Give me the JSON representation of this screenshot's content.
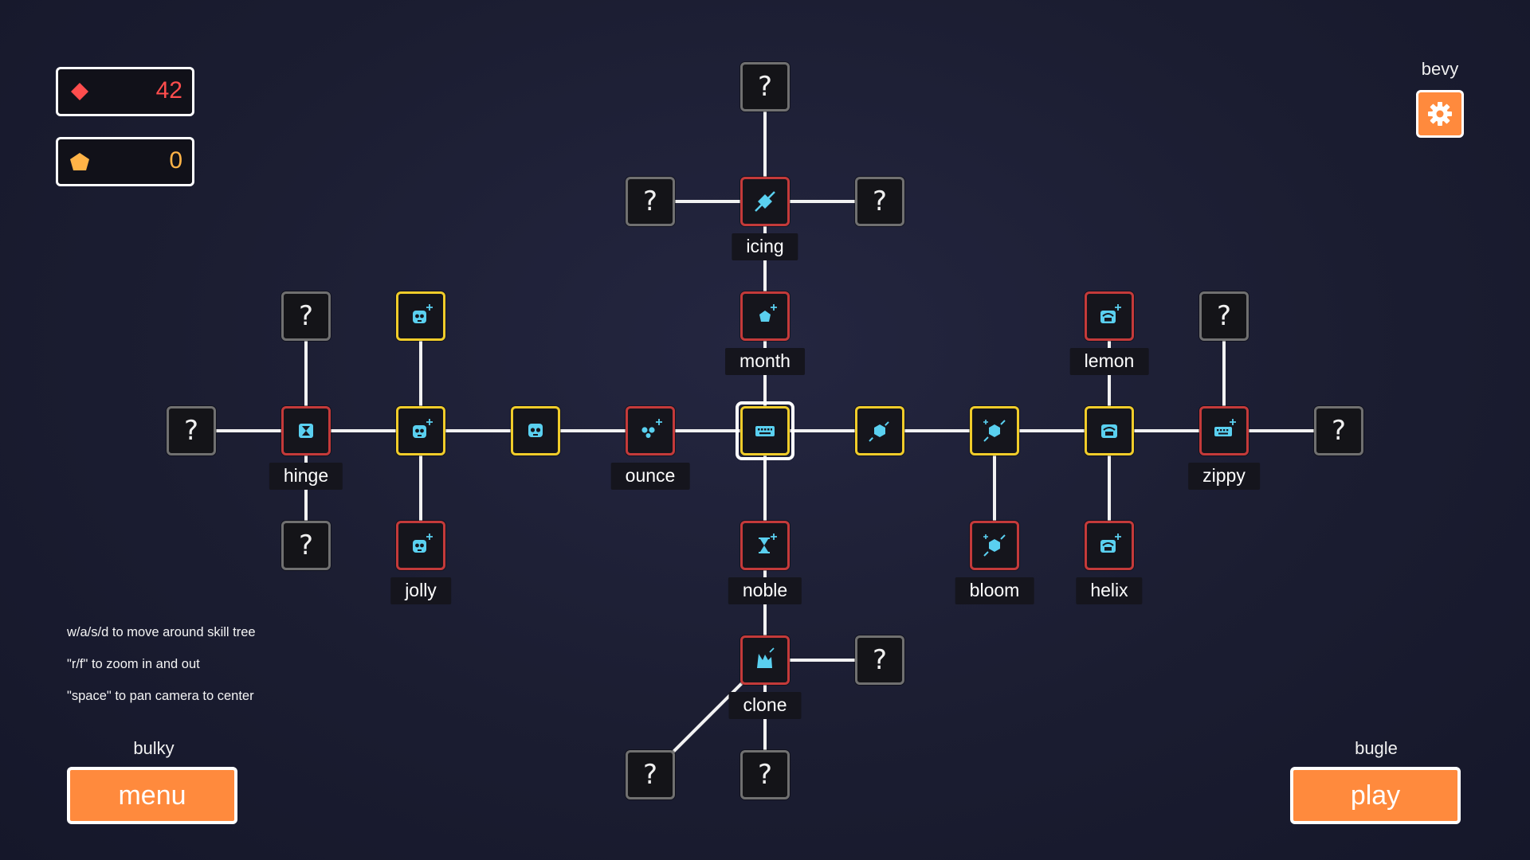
{
  "currencies": {
    "red_gems": {
      "icon": "red-diamond-icon",
      "value": "42",
      "color": "#ff4d4d"
    },
    "gold_gems": {
      "icon": "gold-pentagon-icon",
      "value": "0",
      "color": "#ffb347"
    }
  },
  "hints": [
    "w/a/s/d to move around skill tree",
    "\"r/f\" to zoom in and out",
    "\"space\" to pan camera to center"
  ],
  "top_right": {
    "caption": "bevy",
    "settings_icon": "gear-icon"
  },
  "menu": {
    "caption": "bulky",
    "label": "menu"
  },
  "play": {
    "caption": "bugle",
    "label": "play"
  },
  "colors": {
    "accent": "#ff8a3d",
    "red_border": "#c43a3a",
    "yellow_border": "#f0cc2a",
    "icon_cyan": "#5ad0f0"
  },
  "nodes": [
    {
      "id": "q_top",
      "state": "unknown",
      "text": "?"
    },
    {
      "id": "icing",
      "state": "red",
      "icon": "syringe-icon",
      "label": "icing"
    },
    {
      "id": "q_icing_left",
      "state": "unknown",
      "text": "?"
    },
    {
      "id": "q_icing_right",
      "state": "unknown",
      "text": "?"
    },
    {
      "id": "month",
      "state": "red",
      "icon": "pentagon-plus-icon",
      "label": "month"
    },
    {
      "id": "center",
      "state": "yellow",
      "selected": true,
      "icon": "keyboard-icon"
    },
    {
      "id": "ounce",
      "state": "red",
      "icon": "dots-plus-icon",
      "label": "ounce"
    },
    {
      "id": "skull_a",
      "state": "yellow",
      "icon": "skull-icon"
    },
    {
      "id": "skull_b",
      "state": "yellow",
      "icon": "skull-plus-icon"
    },
    {
      "id": "skull_top",
      "state": "yellow",
      "icon": "skull-plus-icon"
    },
    {
      "id": "jolly",
      "state": "red",
      "icon": "skull-plus-icon",
      "label": "jolly"
    },
    {
      "id": "hinge",
      "state": "red",
      "icon": "hourglass-icon",
      "label": "hinge"
    },
    {
      "id": "q_hinge_top",
      "state": "unknown",
      "text": "?"
    },
    {
      "id": "q_hinge_bottom",
      "state": "unknown",
      "text": "?"
    },
    {
      "id": "q_far_left",
      "state": "unknown",
      "text": "?"
    },
    {
      "id": "noble",
      "state": "red",
      "icon": "hourglass-plus-icon",
      "label": "noble"
    },
    {
      "id": "clone",
      "state": "red",
      "icon": "crown-icon",
      "label": "clone"
    },
    {
      "id": "q_clone_right",
      "state": "unknown",
      "text": "?"
    },
    {
      "id": "q_clone_bottom",
      "state": "unknown",
      "text": "?"
    },
    {
      "id": "q_clone_diag",
      "state": "unknown",
      "text": "?"
    },
    {
      "id": "hex_a",
      "state": "yellow",
      "icon": "hex-line-icon"
    },
    {
      "id": "hex_b",
      "state": "yellow",
      "icon": "hex-burst-icon"
    },
    {
      "id": "bloom",
      "state": "red",
      "icon": "hex-burst-icon",
      "label": "bloom"
    },
    {
      "id": "radio_a",
      "state": "yellow",
      "icon": "radio-icon"
    },
    {
      "id": "lemon",
      "state": "red",
      "icon": "radio-plus-icon",
      "label": "lemon"
    },
    {
      "id": "helix",
      "state": "red",
      "icon": "radio-plus-icon",
      "label": "helix"
    },
    {
      "id": "zippy",
      "state": "red",
      "icon": "keyboard-plus-icon",
      "label": "zippy"
    },
    {
      "id": "q_zippy_top",
      "state": "unknown",
      "text": "?"
    },
    {
      "id": "q_far_right",
      "state": "unknown",
      "text": "?"
    }
  ]
}
